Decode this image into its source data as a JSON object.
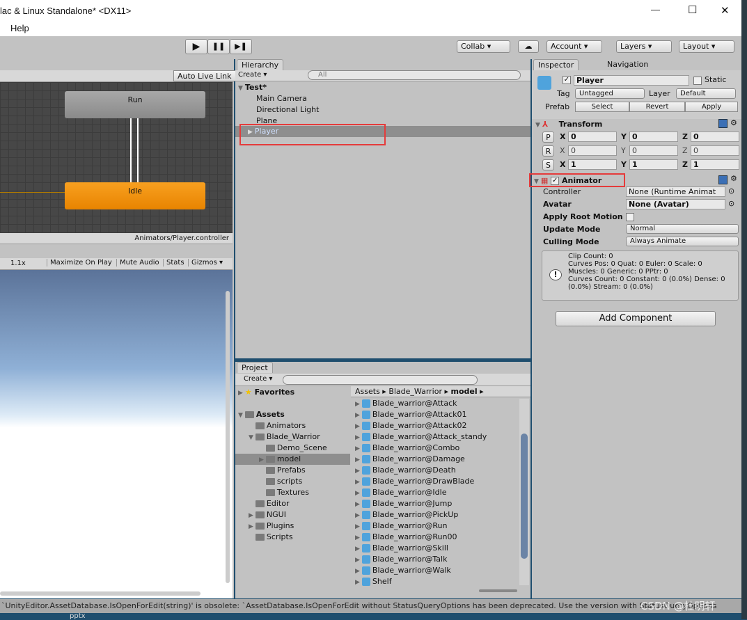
{
  "window": {
    "title": "lac & Linux Standalone* <DX11>",
    "controls": {
      "minimize": "—",
      "maximize": "☐",
      "close": "✕"
    }
  },
  "menu": {
    "items": [
      "Help"
    ]
  },
  "toolbar": {
    "play": "▶",
    "pause": "❚❚",
    "step": "▶❚",
    "collab": "Collab ▾",
    "cloud": "☁",
    "account": "Account ▾",
    "layers": "Layers ▾",
    "layout": "Layout ▾"
  },
  "animator": {
    "auto_live_link": "Auto Live Link",
    "states": [
      {
        "name": "Run",
        "color": "#9a9a9a"
      },
      {
        "name": "Idle",
        "color": "#f08c00"
      }
    ],
    "path": "Animators/Player.controller"
  },
  "game": {
    "scale": "1.1x",
    "buttons": [
      "Maximize On Play",
      "Mute Audio",
      "Stats",
      "Gizmos ▾"
    ]
  },
  "hierarchy": {
    "tab": "Hierarchy",
    "create": "Create ▾",
    "search_placeholder": "All",
    "scene": "Test*",
    "items": [
      "Main Camera",
      "Directional Light",
      "Plane",
      "Player"
    ],
    "selected": "Player"
  },
  "project": {
    "tab": "Project",
    "create": "Create ▾",
    "favorites": "Favorites",
    "tree": [
      {
        "label": "Assets",
        "depth": 0,
        "bold": true
      },
      {
        "label": "Animators",
        "depth": 1
      },
      {
        "label": "Blade_Warrior",
        "depth": 1
      },
      {
        "label": "Demo_Scene",
        "depth": 2
      },
      {
        "label": "model",
        "depth": 2,
        "selected": true
      },
      {
        "label": "Prefabs",
        "depth": 2
      },
      {
        "label": "scripts",
        "depth": 2
      },
      {
        "label": "Textures",
        "depth": 2
      },
      {
        "label": "Editor",
        "depth": 1
      },
      {
        "label": "NGUI",
        "depth": 1
      },
      {
        "label": "Plugins",
        "depth": 1
      },
      {
        "label": "Scripts",
        "depth": 1
      }
    ],
    "breadcrumb": [
      "Assets",
      "Blade_Warrior",
      "model"
    ],
    "files": [
      "Blade_warrior@Attack",
      "Blade_warrior@Attack01",
      "Blade_warrior@Attack02",
      "Blade_warrior@Attack_standy",
      "Blade_warrior@Combo",
      "Blade_warrior@Damage",
      "Blade_warrior@Death",
      "Blade_warrior@DrawBlade",
      "Blade_warrior@Idle",
      "Blade_warrior@Jump",
      "Blade_warrior@PickUp",
      "Blade_warrior@Run",
      "Blade_warrior@Run00",
      "Blade_warrior@Skill",
      "Blade_warrior@Talk",
      "Blade_warrior@Walk",
      "Shelf"
    ]
  },
  "inspector": {
    "tab": "Inspector",
    "tab2": "Navigation",
    "name": "Player",
    "static": "Static",
    "tag_label": "Tag",
    "tag": "Untagged",
    "layer_label": "Layer",
    "layer": "Default",
    "prefab_label": "Prefab",
    "prefab_buttons": [
      "Select",
      "Revert",
      "Apply"
    ],
    "transform": {
      "title": "Transform",
      "rows": [
        {
          "btn": "P",
          "x": "0",
          "y": "0",
          "z": "0"
        },
        {
          "btn": "R",
          "x": "0",
          "y": "0",
          "z": "0"
        },
        {
          "btn": "S",
          "x": "1",
          "y": "1",
          "z": "1"
        }
      ]
    },
    "animator": {
      "title": "Animator",
      "controller_label": "Controller",
      "controller": "None (Runtime Animat",
      "avatar_label": "Avatar",
      "avatar": "None (Avatar)",
      "root_motion_label": "Apply Root Motion",
      "update_label": "Update Mode",
      "update": "Normal",
      "culling_label": "Culling Mode",
      "culling": "Always Animate",
      "info": [
        "Clip Count: 0",
        "Curves Pos: 0 Quat: 0 Euler: 0 Scale: 0",
        "Muscles: 0 Generic: 0 PPtr: 0",
        "Curves Count: 0 Constant: 0 (0.0%) Dense: 0",
        "(0.0%) Stream: 0 (0.0%)"
      ]
    },
    "add_component": "Add Component"
  },
  "status": "`UnityEditor.AssetDatabase.IsOpenForEdit(string)' is obsolete: `AssetDatabase.IsOpenForEdit without StatusQueryOptions has been deprecated. Use the version with StatusQueryOptions",
  "watermark": "CSDN @杜明轩",
  "desktop_label": "pptx"
}
